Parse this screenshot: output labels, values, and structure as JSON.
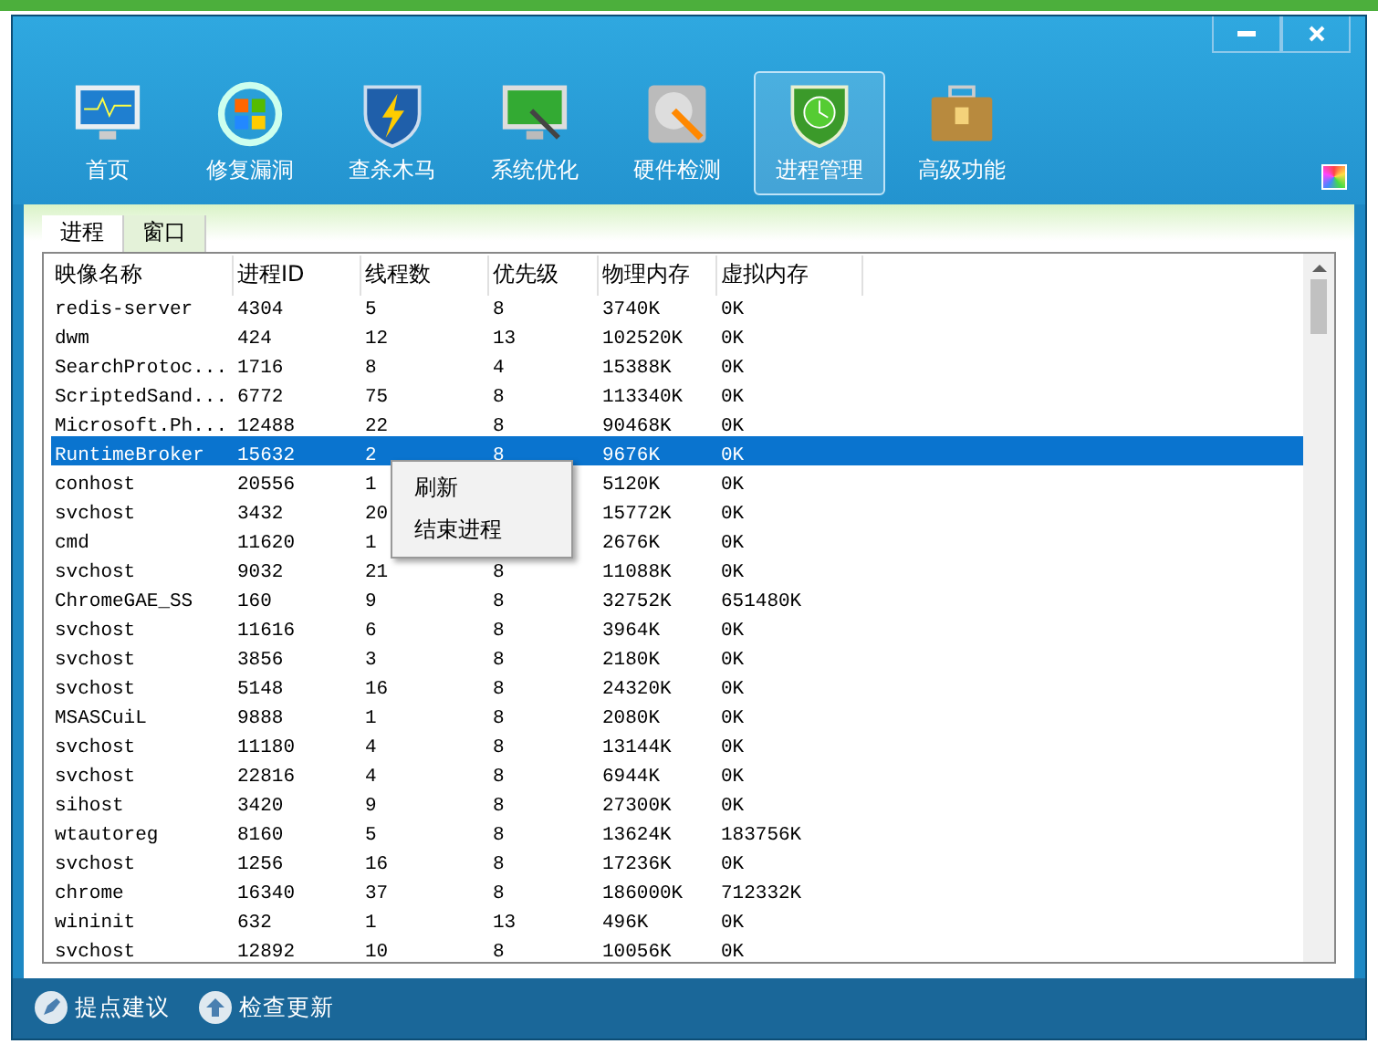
{
  "window": {
    "controls": [
      {
        "kind": "minimize"
      },
      {
        "kind": "close"
      }
    ]
  },
  "toolbar": [
    {
      "label": "首页",
      "selected": false
    },
    {
      "label": "修复漏洞",
      "selected": false
    },
    {
      "label": "查杀木马",
      "selected": false
    },
    {
      "label": "系统优化",
      "selected": false
    },
    {
      "label": "硬件检测",
      "selected": false
    },
    {
      "label": "进程管理",
      "selected": true
    },
    {
      "label": "高级功能",
      "selected": false
    }
  ],
  "tabs": [
    {
      "label": "进程",
      "selected": true
    },
    {
      "label": "窗口",
      "selected": false
    }
  ],
  "table": {
    "columns": [
      "映像名称",
      "进程ID",
      "线程数",
      "优先级",
      "物理内存",
      "虚拟内存"
    ],
    "rows": [
      {
        "cells": [
          "redis-server",
          "4304",
          "5",
          "8",
          "3740K",
          "0K"
        ],
        "selected": false
      },
      {
        "cells": [
          "dwm",
          "424",
          "12",
          "13",
          "102520K",
          "0K"
        ],
        "selected": false
      },
      {
        "cells": [
          "SearchProtoc...",
          "1716",
          "8",
          "4",
          "15388K",
          "0K"
        ],
        "selected": false
      },
      {
        "cells": [
          "ScriptedSand...",
          "6772",
          "75",
          "8",
          "113340K",
          "0K"
        ],
        "selected": false
      },
      {
        "cells": [
          "Microsoft.Ph...",
          "12488",
          "22",
          "8",
          "90468K",
          "0K"
        ],
        "selected": false
      },
      {
        "cells": [
          "RuntimeBroker",
          "15632",
          "2",
          "8",
          "9676K",
          "0K"
        ],
        "selected": true
      },
      {
        "cells": [
          "conhost",
          "20556",
          "1",
          null,
          "5120K",
          "0K"
        ],
        "selected": false
      },
      {
        "cells": [
          "svchost",
          "3432",
          "20",
          null,
          "15772K",
          "0K"
        ],
        "selected": false
      },
      {
        "cells": [
          "cmd",
          "11620",
          "1",
          null,
          "2676K",
          "0K"
        ],
        "selected": false
      },
      {
        "cells": [
          "svchost",
          "9032",
          "21",
          "8",
          "11088K",
          "0K"
        ],
        "selected": false
      },
      {
        "cells": [
          "ChromeGAE_SS",
          "160",
          "9",
          "8",
          "32752K",
          "651480K"
        ],
        "selected": false
      },
      {
        "cells": [
          "svchost",
          "11616",
          "6",
          "8",
          "3964K",
          "0K"
        ],
        "selected": false
      },
      {
        "cells": [
          "svchost",
          "3856",
          "3",
          "8",
          "2180K",
          "0K"
        ],
        "selected": false
      },
      {
        "cells": [
          "svchost",
          "5148",
          "16",
          "8",
          "24320K",
          "0K"
        ],
        "selected": false
      },
      {
        "cells": [
          "MSASCuiL",
          "9888",
          "1",
          "8",
          "2080K",
          "0K"
        ],
        "selected": false
      },
      {
        "cells": [
          "svchost",
          "11180",
          "4",
          "8",
          "13144K",
          "0K"
        ],
        "selected": false
      },
      {
        "cells": [
          "svchost",
          "22816",
          "4",
          "8",
          "6944K",
          "0K"
        ],
        "selected": false
      },
      {
        "cells": [
          "sihost",
          "3420",
          "9",
          "8",
          "27300K",
          "0K"
        ],
        "selected": false
      },
      {
        "cells": [
          "wtautoreg",
          "8160",
          "5",
          "8",
          "13624K",
          "183756K"
        ],
        "selected": false
      },
      {
        "cells": [
          "svchost",
          "1256",
          "16",
          "8",
          "17236K",
          "0K"
        ],
        "selected": false
      },
      {
        "cells": [
          "chrome",
          "16340",
          "37",
          "8",
          "186000K",
          "712332K"
        ],
        "selected": false
      },
      {
        "cells": [
          "wininit",
          "632",
          "1",
          "13",
          "496K",
          "0K"
        ],
        "selected": false
      },
      {
        "cells": [
          "svchost",
          "12892",
          "10",
          "8",
          "10056K",
          "0K"
        ],
        "selected": false
      }
    ]
  },
  "context_menu": {
    "items": [
      "刷新",
      "结束进程"
    ]
  },
  "footer": [
    {
      "label": "提点建议"
    },
    {
      "label": "检查更新"
    }
  ]
}
